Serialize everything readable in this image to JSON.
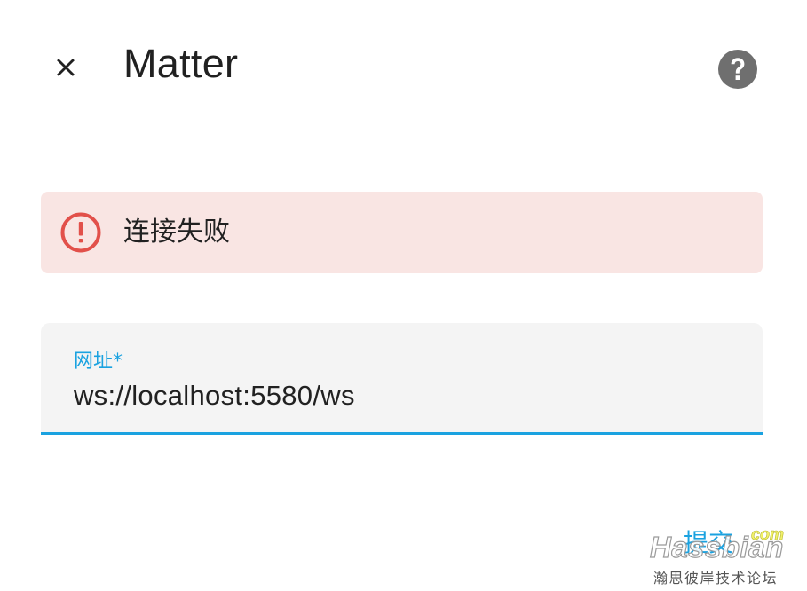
{
  "dialog": {
    "title": "Matter",
    "close_icon": "close-icon",
    "help_icon": "help-circle-icon"
  },
  "alert": {
    "icon": "alert-circle-icon",
    "message": "连接失败",
    "color": "#e2504a",
    "background": "#f9e5e3"
  },
  "form": {
    "url_field": {
      "label": "网址*",
      "value": "ws://localhost:5580/ws",
      "accent": "#1aa2e0"
    }
  },
  "actions": {
    "submit_label": "提交"
  },
  "watermark": {
    "brand": "Hassbian",
    "suffix": "com",
    "tagline": "瀚思彼岸技术论坛"
  }
}
